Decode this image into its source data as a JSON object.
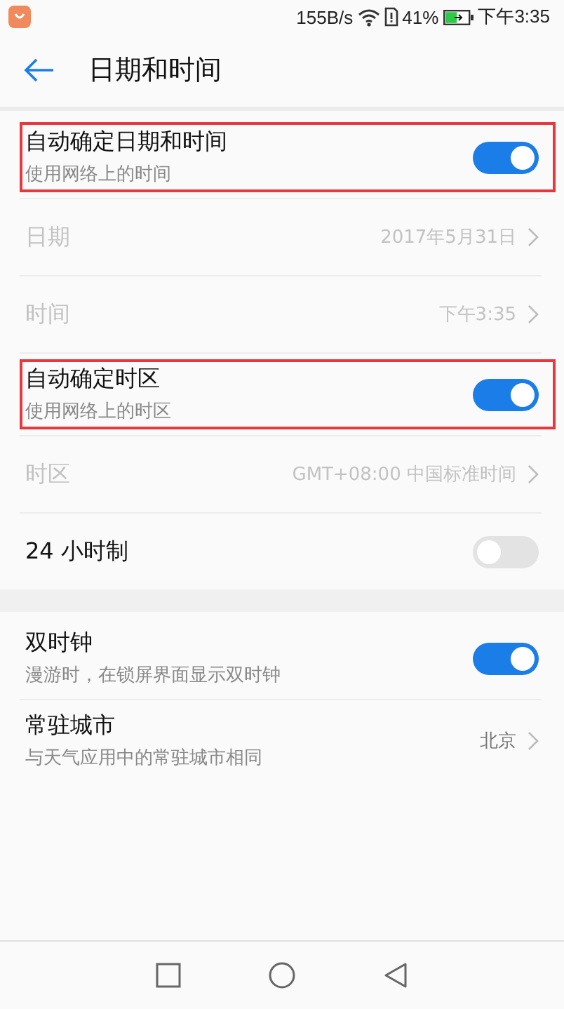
{
  "status_bar": {
    "speed": "155B/s",
    "battery": "41%",
    "time": "下午3:35"
  },
  "header": {
    "title": "日期和时间"
  },
  "groups": [
    {
      "rows": [
        {
          "kind": "switch",
          "title": "自动确定日期和时间",
          "subtitle": "使用网络上的时间",
          "on": true,
          "disabled": false,
          "highlighted": true
        },
        {
          "kind": "link",
          "title": "日期",
          "value": "2017年5月31日",
          "disabled": true,
          "highlighted": false
        },
        {
          "kind": "link",
          "title": "时间",
          "value": "下午3:35",
          "disabled": true,
          "highlighted": false
        },
        {
          "kind": "switch",
          "title": "自动确定时区",
          "subtitle": "使用网络上的时区",
          "on": true,
          "disabled": false,
          "highlighted": true
        },
        {
          "kind": "link",
          "title": "时区",
          "value": "GMT+08:00 中国标准时间",
          "disabled": true,
          "highlighted": false
        },
        {
          "kind": "switch",
          "title": "24 小时制",
          "on": false,
          "disabled": false,
          "highlighted": false
        }
      ]
    },
    {
      "rows": [
        {
          "kind": "switch",
          "title": "双时钟",
          "subtitle": "漫游时，在锁屏界面显示双时钟",
          "on": true,
          "disabled": false,
          "highlighted": false
        },
        {
          "kind": "link",
          "title": "常驻城市",
          "subtitle": "与天气应用中的常驻城市相同",
          "value": "北京",
          "disabled": false,
          "highlighted": false
        }
      ]
    }
  ]
}
